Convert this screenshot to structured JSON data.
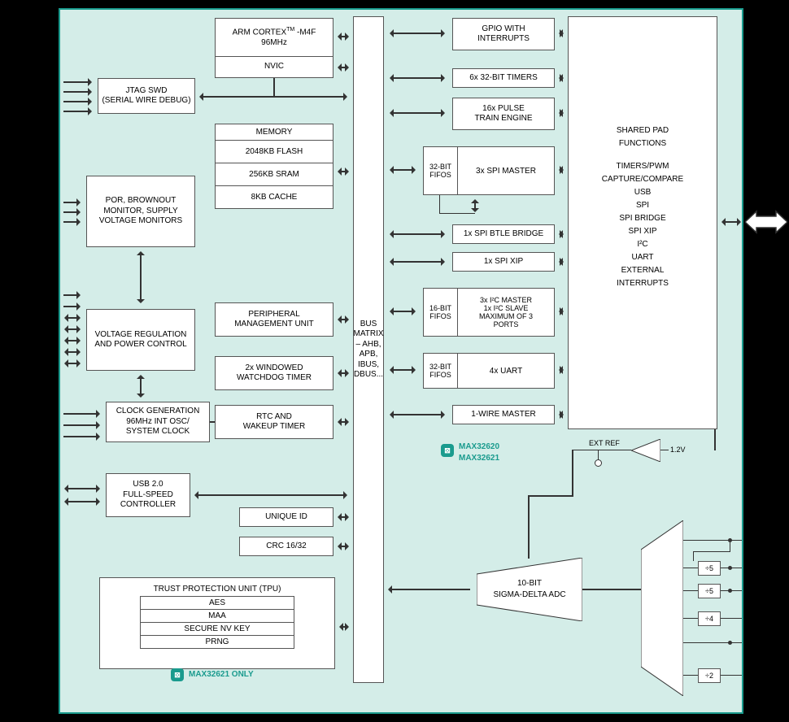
{
  "chip": {
    "product_labels": [
      "MAX32620",
      "MAX32621"
    ],
    "tpu_only": "MAX32621 ONLY"
  },
  "left_col": {
    "jtag": "JTAG SWD\n(SERIAL WIRE DEBUG)",
    "monitors": "POR, BROWNOUT\nMONITOR, SUPPLY\nVOLTAGE MONITORS",
    "vreg": "VOLTAGE REGULATION\nAND POWER CONTROL",
    "clockgen": "CLOCK GENERATION\n96MHz INT OSC/\nSYSTEM CLOCK",
    "usb": "USB 2.0\nFULL-SPEED\nCONTROLLER"
  },
  "mid_col": {
    "cpu_line1": "ARM CORTEX",
    "cpu_tm": "TM",
    "cpu_line2": "-M4F",
    "cpu_freq": "96MHz",
    "nvic": "NVIC",
    "memory_title": "MEMORY",
    "flash": "2048KB FLASH",
    "sram": "256KB SRAM",
    "cache": "8KB CACHE",
    "pmu": "PERIPHERAL\nMANAGEMENT UNIT",
    "wdt": "2x WINDOWED\nWATCHDOG TIMER",
    "rtc": "RTC AND\nWAKEUP TIMER",
    "uid": "UNIQUE ID",
    "crc": "CRC 16/32",
    "tpu_title": "TRUST PROTECTION UNIT (TPU)",
    "tpu_rows": [
      "AES",
      "MAA",
      "SECURE NV KEY",
      "PRNG"
    ]
  },
  "bus": "BUS MATRIX\n– AHB, APB,\nIBUS, DBUS...",
  "periph": {
    "gpio": "GPIO WITH\nINTERRUPTS",
    "timers": "6x 32-BIT TIMERS",
    "pulse": "16x PULSE\nTRAIN ENGINE",
    "fifo32": "32-BIT\nFIFOS",
    "spi_master": "3x SPI MASTER",
    "spi_btle": "1x SPI BTLE BRIDGE",
    "spi_xip": "1x SPI XIP",
    "fifo16": "16-BIT\nFIFOS",
    "i2c": "3x I²C MASTER\n1x I²C SLAVE\nMAXIMUM OF 3\nPORTS",
    "uart": "4x UART",
    "onewire": "1-WIRE MASTER"
  },
  "right": {
    "shared_title": "SHARED PAD\nFUNCTIONS",
    "shared_items": [
      "TIMERS/PWM",
      "CAPTURE/COMPARE",
      "",
      "USB",
      "SPI",
      "SPI BRIDGE",
      "SPI XIP",
      "I²C",
      "UART",
      "",
      "EXTERNAL",
      "INTERRUPTS"
    ]
  },
  "analog": {
    "extref": "EXT REF",
    "vref": "1.2V",
    "adc": "10-BIT\nSIGMA-DELTA ADC",
    "dividers": [
      "÷5",
      "÷5",
      "÷4",
      "",
      "÷2"
    ]
  }
}
